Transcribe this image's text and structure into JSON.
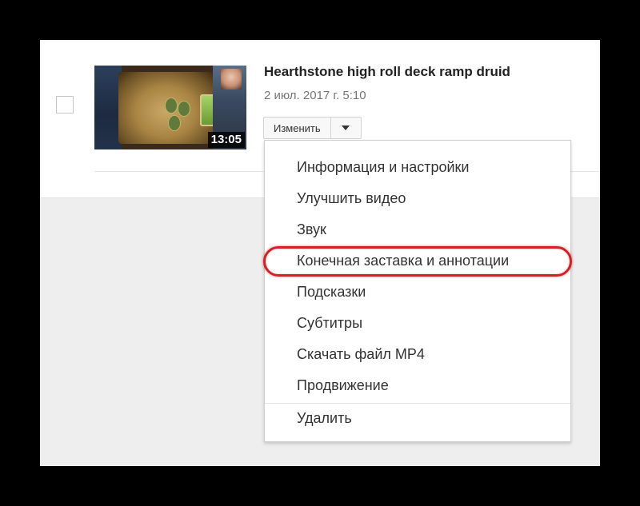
{
  "video": {
    "title": "Hearthstone high roll deck ramp druid",
    "date": "2 июл. 2017 г. 5:10",
    "duration": "13:05"
  },
  "actions": {
    "edit_label": "Изменить"
  },
  "menu": {
    "items": [
      {
        "label": "Информация и настройки"
      },
      {
        "label": "Улучшить видео"
      },
      {
        "label": "Звук"
      },
      {
        "label": "Конечная заставка и аннотации",
        "highlighted": true
      },
      {
        "label": "Подсказки"
      },
      {
        "label": "Субтитры"
      },
      {
        "label": "Скачать файл MP4"
      },
      {
        "label": "Продвижение"
      },
      {
        "label": "Удалить"
      }
    ]
  },
  "colors": {
    "highlight": "#d61f26",
    "background": "#000000",
    "panel": "#eeeeee"
  }
}
